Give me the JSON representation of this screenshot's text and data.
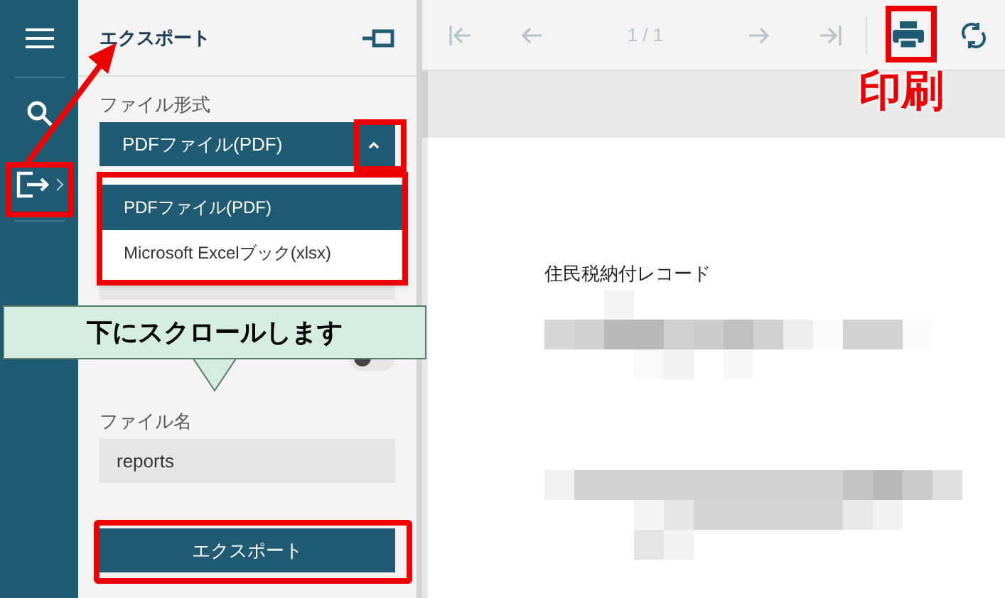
{
  "panel": {
    "title": "エクスポート",
    "format_label": "ファイル形式",
    "format_value": "PDFファイル(PDF)",
    "dropdown_expanded": true,
    "format_options": [
      {
        "label": "PDFファイル(PDF)",
        "selected": true
      },
      {
        "label": "Microsoft Excelブック(xlsx)",
        "selected": false
      }
    ],
    "print_toggle_on": false,
    "file_name_label": "ファイル名",
    "file_name_value": "reports",
    "export_button": "エクスポート"
  },
  "toolbar": {
    "nav_buttons": [
      {
        "kind": "first",
        "disabled": true
      },
      {
        "kind": "prev",
        "disabled": true
      }
    ],
    "page_indicator": "1 / 1",
    "nav_buttons_after": [
      {
        "kind": "next",
        "disabled": true
      },
      {
        "kind": "last",
        "disabled": true
      }
    ]
  },
  "document": {
    "title": "住民税納付レコード"
  },
  "annotations": {
    "callout": "下にスクロールします",
    "print_label": "印刷"
  }
}
